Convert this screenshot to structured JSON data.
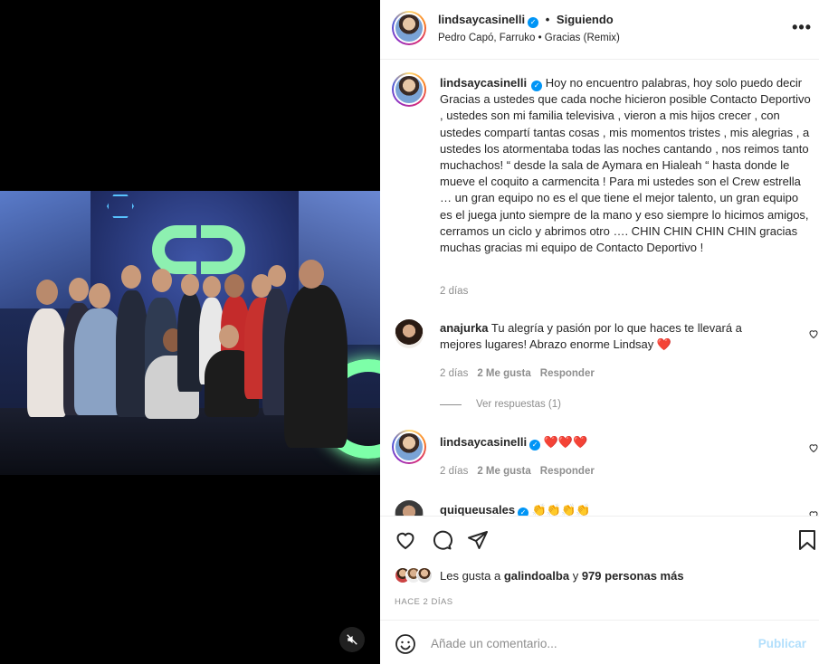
{
  "post_header": {
    "username": "lindsaycasinelli",
    "separator": "•",
    "follow_status": "Siguiendo",
    "song": "Pedro Capó, Farruko • Gracias (Remix)",
    "more_label": "•••"
  },
  "caption": {
    "username": "lindsaycasinelli",
    "text": "Hoy no encuentro palabras, hoy solo puedo decir Gracias a ustedes que cada noche hicieron posible Contacto Deportivo , ustedes son mi familia televisiva , vieron a mis hijos crecer , con ustedes compartí tantas cosas , mis momentos tristes , mis alegrias , a ustedes los atormentaba todas las noches cantando , nos reimos tanto muchachos! “ desde la sala de Aymara en Hialeah “ hasta donde le mueve el coquito a carmencita ! Para mi ustedes son el Crew estrella … un gran equipo no es el que tiene el mejor talento, un gran equipo es el juega junto siempre de la mano y eso siempre lo hicimos amigos, cerramos un ciclo y abrimos otro …. CHIN CHIN CHIN CHIN gracias muchas gracias mi equipo de Contacto Deportivo !",
    "time": "2 días"
  },
  "comments": [
    {
      "username": "anajurka",
      "text": "Tu alegría y pasión por lo que haces te llevará a mejores lugares! Abrazo enorme Lindsay",
      "emoji": "❤️",
      "time": "2 días",
      "likes": "2 Me gusta",
      "reply": "Responder",
      "view_replies": "Ver respuestas (1)"
    },
    {
      "username": "lindsaycasinelli",
      "emoji": "❤️❤️❤️",
      "time": "2 días",
      "likes": "2 Me gusta",
      "reply": "Responder"
    },
    {
      "username": "quiqueusales",
      "emoji": "👏👏👏👏"
    }
  ],
  "likes": {
    "prefix": "Les gusta a",
    "user": "galindoalba",
    "connector": "y",
    "others": "979 personas más"
  },
  "time_ago": "HACE 2 DÍAS",
  "add_comment": {
    "placeholder": "Añade un comentario...",
    "publish": "Publicar"
  },
  "media": {
    "logo_text": "CD"
  },
  "colors": {
    "verified": "#0095f6",
    "publish_disabled": "#b2dffc",
    "heart_red": "#e0245e"
  }
}
